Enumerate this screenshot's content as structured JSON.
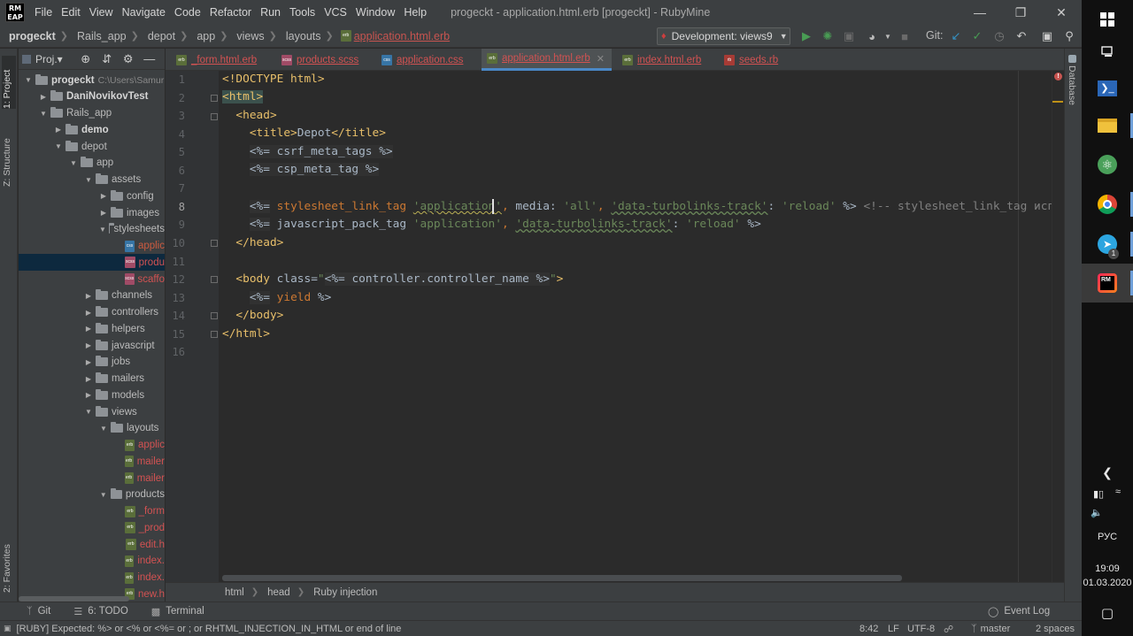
{
  "window": {
    "logo_line1": "RM",
    "logo_line2": "EAP",
    "menu": [
      "File",
      "Edit",
      "View",
      "Navigate",
      "Code",
      "Refactor",
      "Run",
      "Tools",
      "VCS",
      "Window",
      "Help"
    ],
    "title": "progeckt - application.html.erb [progeckt] - RubyMine"
  },
  "navbar": {
    "breadcrumbs": [
      "progeckt",
      "Rails_app",
      "depot",
      "app",
      "views",
      "layouts"
    ],
    "file": "application.html.erb",
    "run_config": "Development: views9",
    "git_label": "Git:"
  },
  "left_strip": {
    "project_tab": "1: Project",
    "structure_tab": "Z: Structure",
    "favorites_tab": "2: Favorites"
  },
  "project_panel": {
    "title": "Proj.▾",
    "tree": [
      {
        "label": "progeckt",
        "extra": "C:\\Users\\Samur",
        "bold": true
      },
      {
        "label": "DaniNovikovTest",
        "bold": true
      },
      {
        "label": "Rails_app"
      },
      {
        "label": "demo",
        "bold": true
      },
      {
        "label": "depot"
      },
      {
        "label": "app"
      },
      {
        "label": "assets"
      },
      {
        "label": "config"
      },
      {
        "label": "images"
      },
      {
        "label": "stylesheets"
      },
      {
        "label": "applic",
        "icon": "css"
      },
      {
        "label": "produ",
        "icon": "scss"
      },
      {
        "label": "scaffo",
        "icon": "scss"
      },
      {
        "label": "channels"
      },
      {
        "label": "controllers"
      },
      {
        "label": "helpers"
      },
      {
        "label": "javascript"
      },
      {
        "label": "jobs"
      },
      {
        "label": "mailers"
      },
      {
        "label": "models"
      },
      {
        "label": "views"
      },
      {
        "label": "layouts"
      },
      {
        "label": "applic",
        "icon": "erb"
      },
      {
        "label": "mailer",
        "icon": "erb"
      },
      {
        "label": "mailer",
        "icon": "erb"
      },
      {
        "label": "products"
      },
      {
        "label": "_form",
        "icon": "erb"
      },
      {
        "label": "_prod",
        "icon": "erb"
      },
      {
        "label": "edit.h",
        "icon": "erb"
      },
      {
        "label": "index.",
        "icon": "erb"
      },
      {
        "label": "index.",
        "icon": "erb"
      },
      {
        "label": "new.h",
        "icon": "erb"
      }
    ]
  },
  "tabs": [
    {
      "label": "_form.html.erb",
      "icon": "erb"
    },
    {
      "label": "products.scss",
      "icon": "scss"
    },
    {
      "label": "application.css",
      "icon": "css"
    },
    {
      "label": "application.html.erb",
      "icon": "erb",
      "active": true
    },
    {
      "label": "index.html.erb",
      "icon": "erb"
    },
    {
      "label": "seeds.rb",
      "icon": "rb"
    }
  ],
  "editor": {
    "line_numbers": [
      "1",
      "2",
      "3",
      "4",
      "5",
      "6",
      "7",
      "8",
      "9",
      "10",
      "11",
      "12",
      "13",
      "14",
      "15",
      "16"
    ],
    "current_line": "8",
    "code": {
      "l1": "<!DOCTYPE html>",
      "l2_tag": "<html>",
      "l3_tag": "<head>",
      "l4_open": "<title>",
      "l4_text": "Depot",
      "l4_close": "</title>",
      "l5": "<%= csrf_meta_tags %>",
      "l6": "<%= csp_meta_tag %>",
      "l8_open": "<%=",
      "l8_method": "stylesheet_link_tag",
      "l8_arg": "'application'",
      "l8_comma": ",",
      "l8_key1": "media:",
      "l8_val1": "'all'",
      "l8_key2": "'data-turbolinks-track'",
      "l8_colon": ":",
      "l8_val2": "'reload'",
      "l8_close": "%>",
      "l8_comment": "<!-- stylesheet_link_tag используе",
      "l9_open": "<%=",
      "l9_method": "javascript_pack_tag",
      "l9_arg": "'application'",
      "l9_key": "'data-turbolinks-track'",
      "l9_val": "'reload'",
      "l9_close": "%>",
      "l10": "</head>",
      "l12_tag": "<body",
      "l12_attr": "class=",
      "l12_q1": "\"",
      "l12_erb_open": "<%=",
      "l12_expr": "controller.controller_name",
      "l12_erb_close": "%>",
      "l12_q2": "\"",
      "l12_end": ">",
      "l13_open": "<%=",
      "l13_kw": "yield",
      "l13_close": "%>",
      "l14": "</body>",
      "l15": "</html>"
    }
  },
  "editor_crumbs": [
    "html",
    "head",
    "Ruby injection"
  ],
  "right_strip": {
    "database_tab": "Database"
  },
  "bottom_tools": {
    "git": "Git",
    "todo": "6: TODO",
    "terminal": "Terminal",
    "event_log": "Event Log"
  },
  "statusbar": {
    "message": "[RUBY] Expected: %> or <% or <%= or ; or RHTML_INJECTION_IN_HTML or end of line",
    "position": "8:42",
    "line_sep": "LF",
    "encoding": "UTF-8",
    "branch": "master",
    "indent": "2 spaces"
  },
  "taskbar": {
    "language": "РУС",
    "time": "19:09",
    "date": "01.03.2020",
    "telegram_badge": "1"
  },
  "colors": {
    "accent": "#4a88c7",
    "error": "#c75450",
    "string": "#6a8759",
    "keyword": "#cc7832",
    "tag": "#e8bf6a"
  }
}
